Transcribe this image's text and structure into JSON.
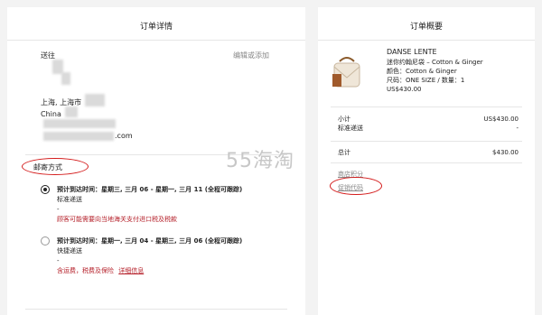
{
  "left": {
    "title": "订单详情",
    "section_shipto": "送往",
    "edit_add": "编辑或添加",
    "city": "上海, 上海市",
    "country": "China",
    "email_suffix": ".com",
    "shipping_method_label": "邮寄方式",
    "option1": {
      "eta": "预计到达时间：星期三, 三月 06 - 星期一, 三月 11 (全程可跟踪)",
      "type": "标准递送",
      "dash": "-",
      "note": "顾客可能需要向当地海关支付进口税及税款"
    },
    "option2": {
      "eta": "预计到达时间：星期一, 三月 04 - 星期三, 三月 06 (全程可跟踪)",
      "type": "快捷递送",
      "dash": "-",
      "note": "含运费，税费及保险",
      "detail_link": "详细信息"
    }
  },
  "right": {
    "title": "订单概要",
    "product": {
      "brand": "DANSE LENTE",
      "name": "迷你约翰尼袋 – Cotton & Ginger",
      "color": "颜色：Cotton & Ginger",
      "size_qty": "尺码：ONE SIZE / 数量：1",
      "price": "US$430.00"
    },
    "subtotal_label": "小计",
    "subtotal_value": "US$430.00",
    "shipping_label": "标准递送",
    "shipping_value": "-",
    "total_label": "总计",
    "total_value": "$430.00",
    "store_credit": "商店积分",
    "promo_code": "促销代码"
  },
  "watermark": "55海淘"
}
